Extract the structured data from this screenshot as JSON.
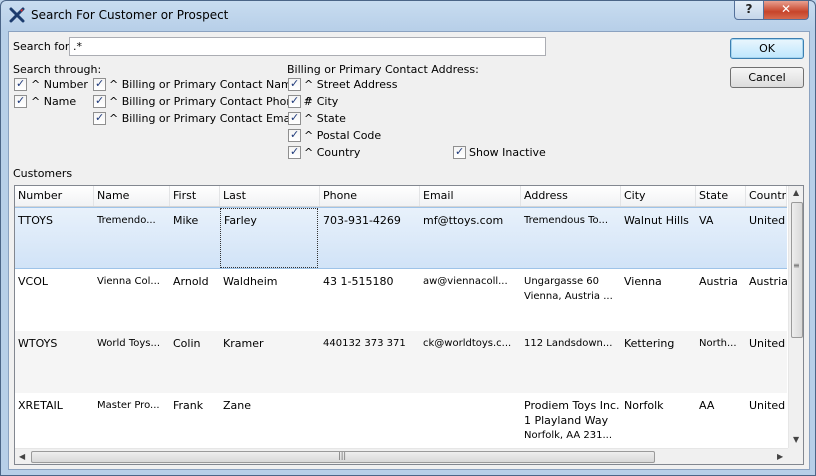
{
  "window": {
    "title": "Search For Customer or Prospect",
    "help_label": "?",
    "close_label": "✕"
  },
  "search": {
    "label": "Search for:",
    "value": ".*"
  },
  "search_through": {
    "label": "Search through:",
    "number": "^ Number",
    "name": "^ Name",
    "contact_name": "^ Billing or Primary Contact Name",
    "contact_phone": "^ Billing or Primary Contact Phone #",
    "contact_email": "^ Billing or Primary Contact Email"
  },
  "address": {
    "label": "Billing or Primary Contact Address:",
    "street": "^ Street Address",
    "city": "^ City",
    "state": "^ State",
    "postal": "^ Postal Code",
    "country": "^ Country"
  },
  "show_inactive": "Show Inactive",
  "buttons": {
    "ok": "OK",
    "cancel": "Cancel"
  },
  "customers_label": "Customers",
  "columns": [
    "Number",
    "Name",
    "First",
    "Last",
    "Phone",
    "Email",
    "Address",
    "City",
    "State",
    "Country"
  ],
  "rows": [
    {
      "number": "TTOYS",
      "name": "Tremendo...",
      "first": "Mike",
      "last": "Farley",
      "phone": "703-931-4269",
      "email": "mf@ttoys.com",
      "address1": "Tremendous To...",
      "address2": "",
      "address3": "",
      "city": "Walnut Hills",
      "state": "VA",
      "country": "United"
    },
    {
      "number": "VCOL",
      "name": "Vienna Col...",
      "first": "Arnold",
      "last": "Waldheim",
      "phone": "43 1-515180",
      "email": "aw@viennacoll...",
      "address1": "Ungargasse 60",
      "address2": "Vienna, Austria ...",
      "address3": "",
      "city": "Vienna",
      "state": "Austria",
      "country": "Austria"
    },
    {
      "number": "WTOYS",
      "name": "World Toys...",
      "first": "Colin",
      "last": "Kramer",
      "phone": "440132 373 371",
      "email": "ck@worldtoys.c...",
      "address1": "112 Landsdown...",
      "address2": "",
      "address3": "",
      "city": "Kettering",
      "state": "North...",
      "country": "United"
    },
    {
      "number": "XRETAIL",
      "name": "Master Pro...",
      "first": "Frank",
      "last": "Zane",
      "phone": "",
      "email": "",
      "address1": "Prodiem Toys Inc.",
      "address2": "1 Playland Way",
      "address3": "Norfolk, AA 231...",
      "city": "Norfolk",
      "state": "AA",
      "country": "United"
    }
  ]
}
